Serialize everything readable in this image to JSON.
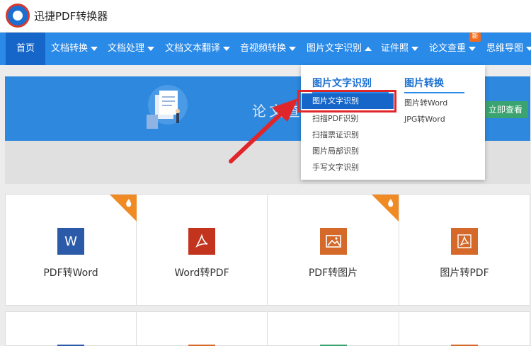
{
  "app": {
    "title": "迅捷PDF转换器"
  },
  "nav": {
    "items": [
      {
        "label": "首页",
        "caret": "none"
      },
      {
        "label": "文档转换",
        "caret": "down"
      },
      {
        "label": "文档处理",
        "caret": "down"
      },
      {
        "label": "文档文本翻译",
        "caret": "down"
      },
      {
        "label": "音视频转换",
        "caret": "down"
      },
      {
        "label": "图片文字识别",
        "caret": "up"
      },
      {
        "label": "证件照",
        "caret": "down"
      },
      {
        "label": "论文查重",
        "caret": "down"
      },
      {
        "label": "思维导图",
        "caret": "down"
      }
    ],
    "new_badge": "新"
  },
  "banner": {
    "text": "论文查",
    "button": "立即查看"
  },
  "dropdown": {
    "col1": {
      "title": "图片文字识别",
      "items": [
        "图片文字识别",
        "扫描PDF识别",
        "扫描票证识别",
        "图片局部识别",
        "手写文字识别"
      ],
      "active_index": 0
    },
    "col2": {
      "title": "图片转换",
      "items": [
        "图片转Word",
        "JPG转Word"
      ]
    }
  },
  "tools": [
    {
      "label": "PDF转Word",
      "icon": "word-icon",
      "glyph": "W",
      "color": "#2b5ba8",
      "hot": true
    },
    {
      "label": "Word转PDF",
      "icon": "pdf-icon",
      "glyph": "",
      "color": "#c2341e",
      "hot": false
    },
    {
      "label": "PDF转图片",
      "icon": "image-icon",
      "glyph": "",
      "color": "#d4692a",
      "hot": true
    },
    {
      "label": "图片转PDF",
      "icon": "pdf-icon",
      "glyph": "",
      "color": "#d4692a",
      "hot": false
    }
  ],
  "colors": {
    "nav_bg": "#2a8ae8",
    "nav_active": "#1566c8",
    "highlight_red": "#e0262a",
    "hot_orange": "#f08a24"
  }
}
